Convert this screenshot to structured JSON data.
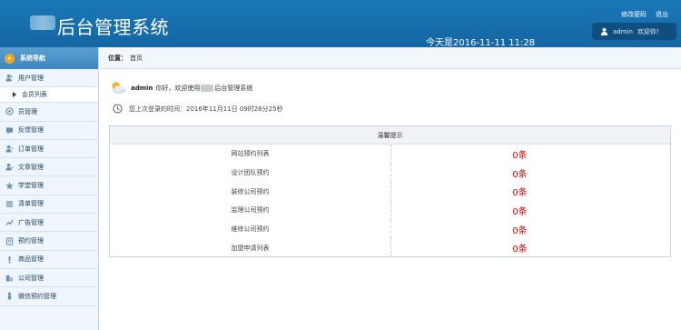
{
  "header": {
    "title": "后台管理系统",
    "links": [
      "修改密码",
      "退出"
    ],
    "date": "今天是2016-11-11 11:28",
    "user_name": "admin",
    "user_greeting": "欢迎你！"
  },
  "sidebar": {
    "nav_title": "系统导航",
    "items": [
      {
        "label": "用户管理",
        "icon": "users-icon"
      },
      {
        "label": "员管理",
        "icon": "user-manage-icon"
      },
      {
        "label": "反馈管理",
        "icon": "feedback-icon"
      },
      {
        "label": "订单管理",
        "icon": "order-icon"
      },
      {
        "label": "文章管理",
        "icon": "article-icon"
      },
      {
        "label": "学堂管理",
        "icon": "star-icon"
      },
      {
        "label": "清单管理",
        "icon": "list-icon"
      },
      {
        "label": "广告管理",
        "icon": "ad-icon"
      },
      {
        "label": "预约管理",
        "icon": "appointment-icon"
      },
      {
        "label": "商品管理",
        "icon": "product-icon"
      },
      {
        "label": "公司管理",
        "icon": "company-icon"
      },
      {
        "label": "微信预约管理",
        "icon": "wechat-icon"
      }
    ],
    "sub_item": "会员列表"
  },
  "breadcrumb": {
    "label": "位置：",
    "page": "首页"
  },
  "welcome": {
    "name": "admin",
    "text_before": "你好，欢迎使用",
    "text_after": "后台管理系统"
  },
  "lastlogin": {
    "text": "您上次登录的时间：2016年11月11日 09时26分25秒"
  },
  "tips": {
    "title": "温馨提示",
    "rows": [
      {
        "label": "网站预约列表",
        "value": "0条"
      },
      {
        "label": "设计团队预约",
        "value": "0条"
      },
      {
        "label": "装修公司预约",
        "value": "0条"
      },
      {
        "label": "监理公司预约",
        "value": "0条"
      },
      {
        "label": "维修公司预约",
        "value": "0条"
      },
      {
        "label": "加盟申请列表",
        "value": "0条"
      }
    ]
  },
  "colors": {
    "header": "#1a78b8",
    "accent_red": "#e60000"
  }
}
